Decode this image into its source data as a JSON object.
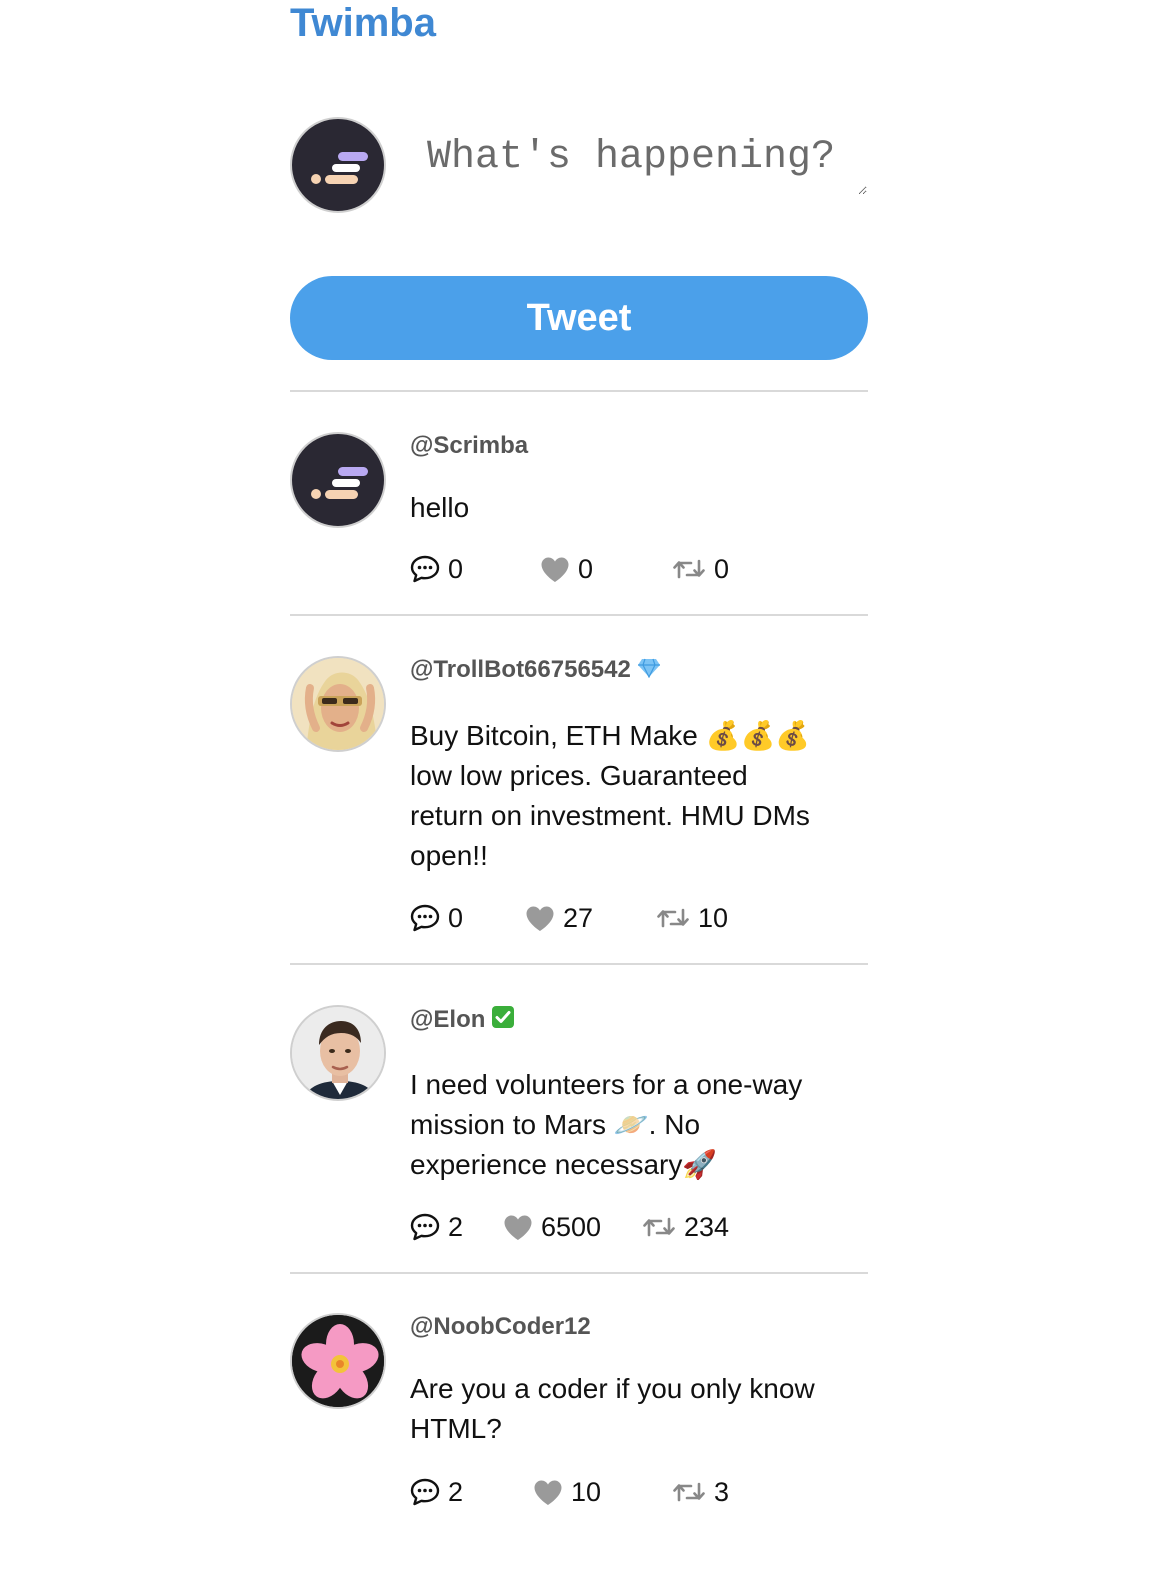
{
  "app": {
    "title": "Twimba"
  },
  "composer": {
    "placeholder": "What's happening?",
    "button_label": "Tweet"
  },
  "colors": {
    "brand": "#3f88d3",
    "button": "#4ba0ea",
    "avatar_bg": "#2a2833"
  },
  "tweets": [
    {
      "handle": "@Scrimba",
      "badge": "",
      "avatar": "scrimba-logo",
      "text": "hello",
      "replies": "0",
      "likes": "0",
      "retweets": "0"
    },
    {
      "handle": "@TrollBot66756542",
      "badge": "diamond-icon",
      "avatar": "troll-avatar",
      "text": "Buy Bitcoin, ETH Make 💰💰💰 low low prices. Guaranteed return on investment. HMU DMs open!!",
      "replies": "0",
      "likes": "27",
      "retweets": "10"
    },
    {
      "handle": "@Elon",
      "badge": "verified-check-icon",
      "avatar": "elon-avatar",
      "text": "I need volunteers for a one-way mission to Mars 🪐. No experience necessary🚀",
      "replies": "2",
      "likes": "6500",
      "retweets": "234"
    },
    {
      "handle": "@NoobCoder12",
      "badge": "",
      "avatar": "flower-avatar",
      "text": "Are you a coder if you only know HTML?",
      "replies": "2",
      "likes": "10",
      "retweets": "3"
    }
  ]
}
